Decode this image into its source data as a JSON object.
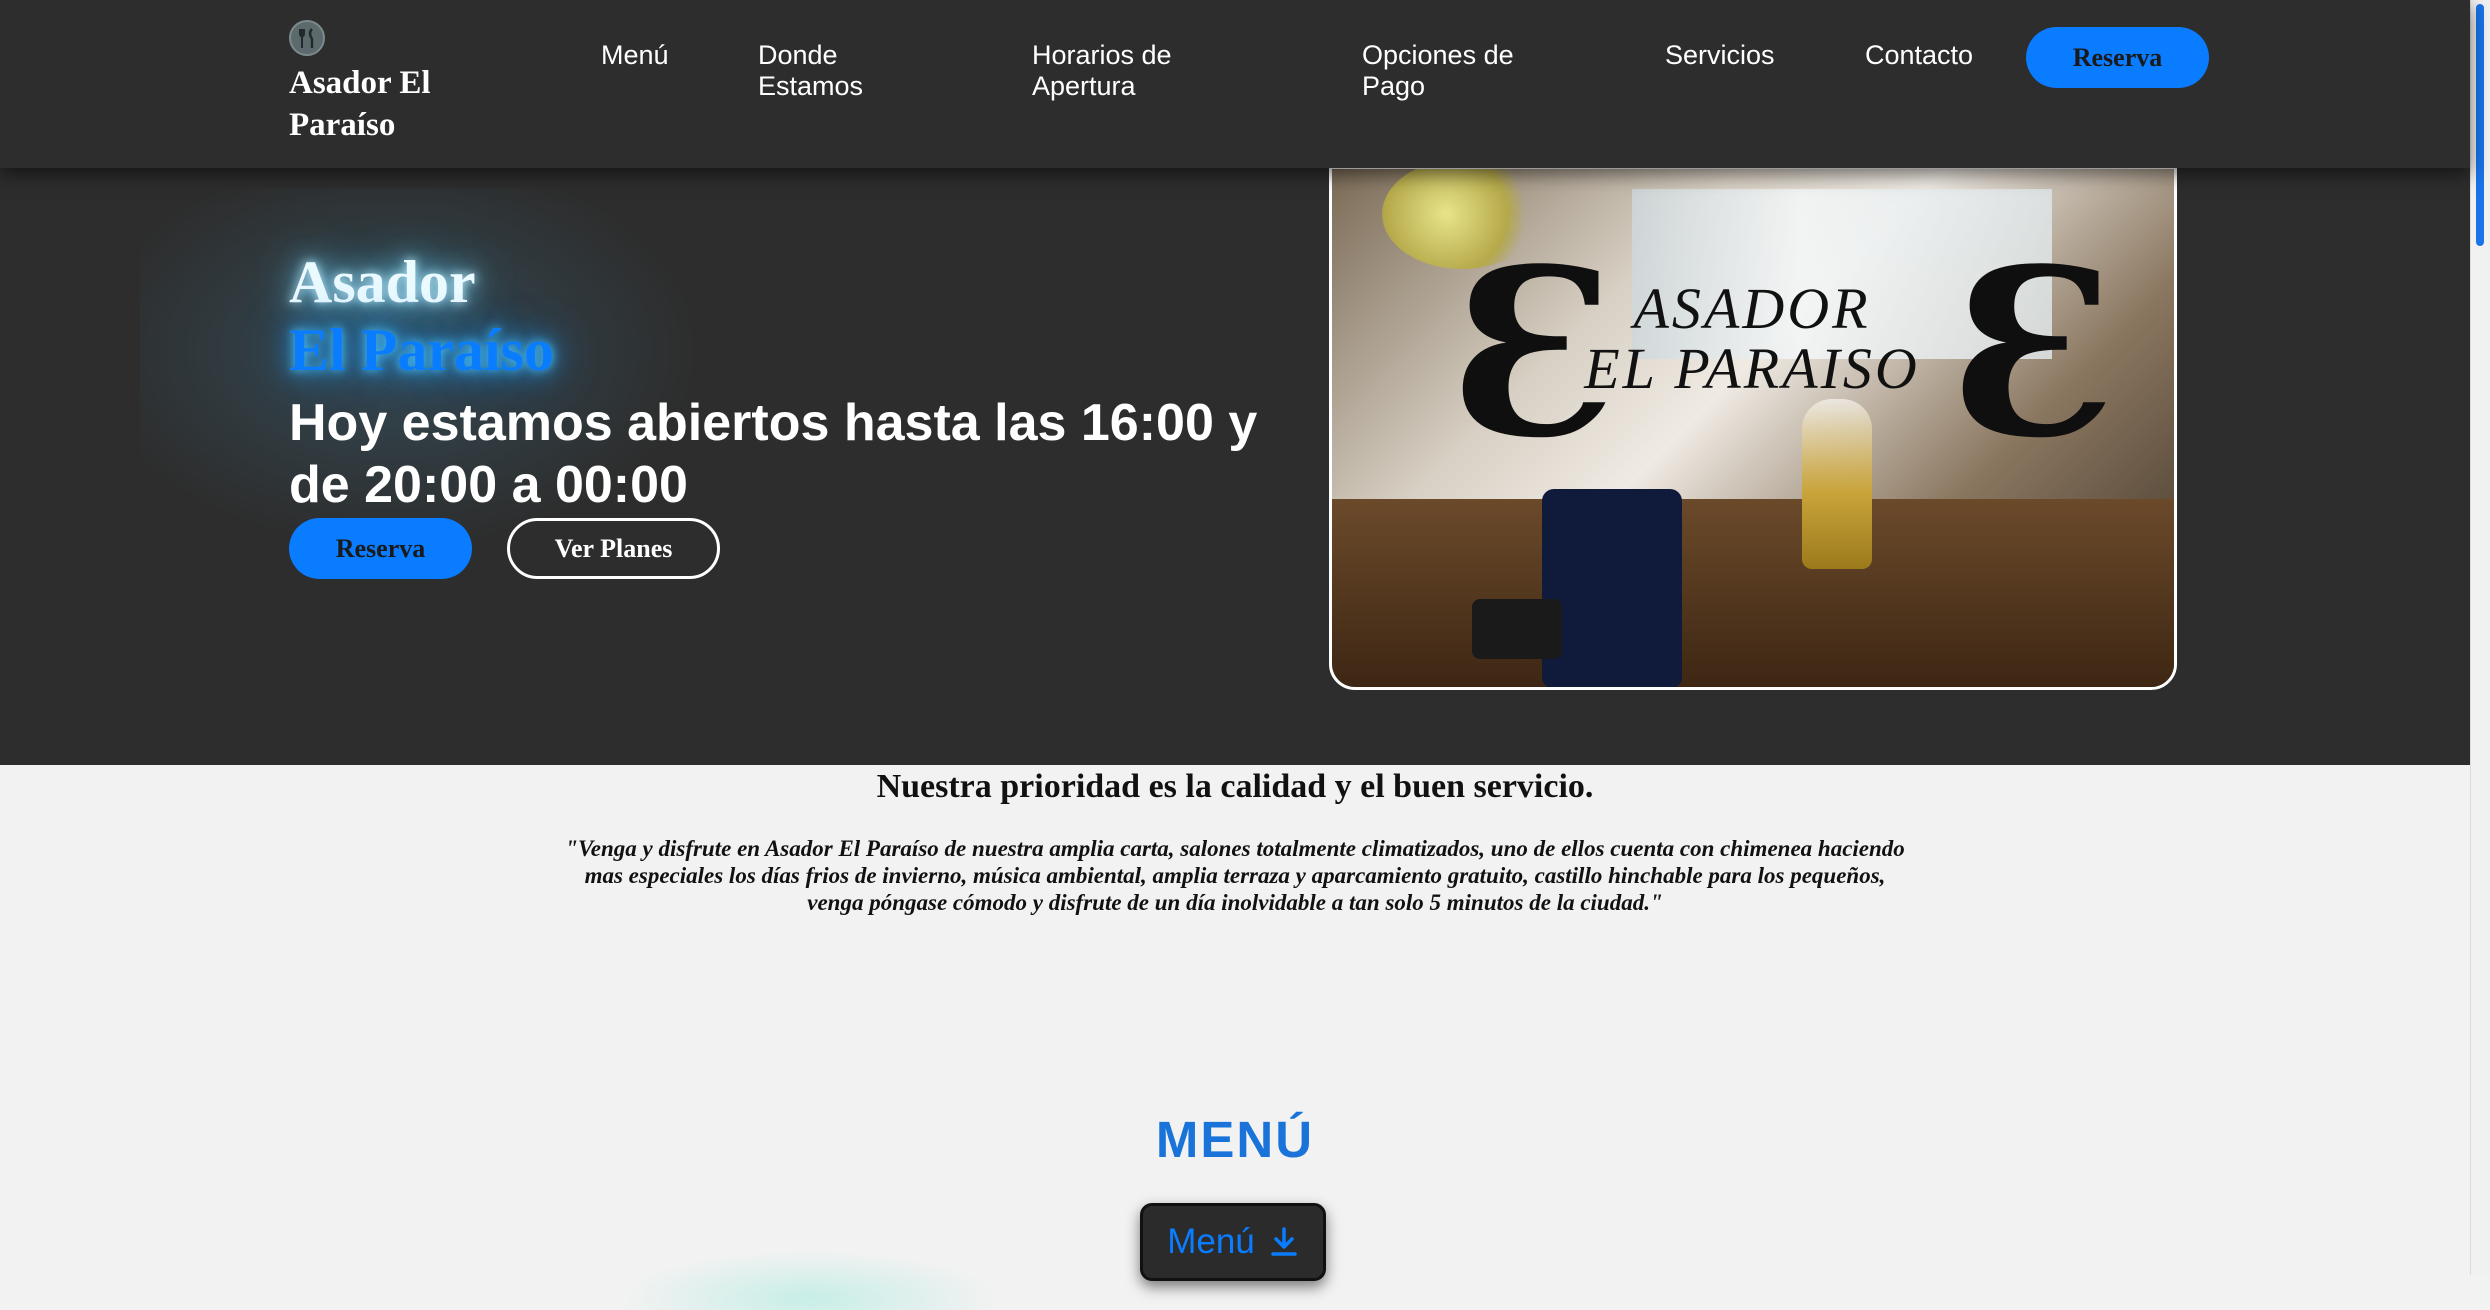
{
  "header": {
    "logo_icon": "cutlery-icon",
    "brand": "Asador El Paraíso",
    "nav": [
      {
        "label": "Menú"
      },
      {
        "label": "Donde Estamos"
      },
      {
        "label": "Horarios de Apertura"
      },
      {
        "label": "Opciones de Pago"
      },
      {
        "label": "Servicios"
      },
      {
        "label": "Contacto"
      }
    ],
    "cta_label": "Reserva"
  },
  "hero": {
    "title_line1": "Asador",
    "title_line2": "El Paraíso",
    "subtitle": "Hoy estamos abiertos hasta las 16:00 y de 20:00 a 00:00",
    "reserve_label": "Reserva",
    "plans_label": "Ver Planes",
    "image_sign_line1": "ASADOR",
    "image_sign_line2": "EL PARAISO"
  },
  "intro": {
    "heading": "Nuestra prioridad es la calidad y el buen servicio.",
    "quote": "\"Venga y disfrute en Asador El Paraíso de nuestra amplia carta, salones totalmente climatizados, uno de ellos cuenta con chimenea haciendo mas especiales los días frios de invierno, música ambiental, amplia terraza y aparcamiento gratuito, castillo hinchable para los pequeños, venga póngase cómodo y disfrute de un día inolvidable a tan solo 5 minutos de la ciudad.\""
  },
  "menu_section": {
    "title": "MENÚ",
    "download_label": "Menú",
    "download_icon": "download-icon"
  },
  "colors": {
    "accent": "#0a7cff",
    "header_bg": "#2d2d2d",
    "page_bg": "#f2f2f2",
    "section_title": "#1a73d9"
  }
}
